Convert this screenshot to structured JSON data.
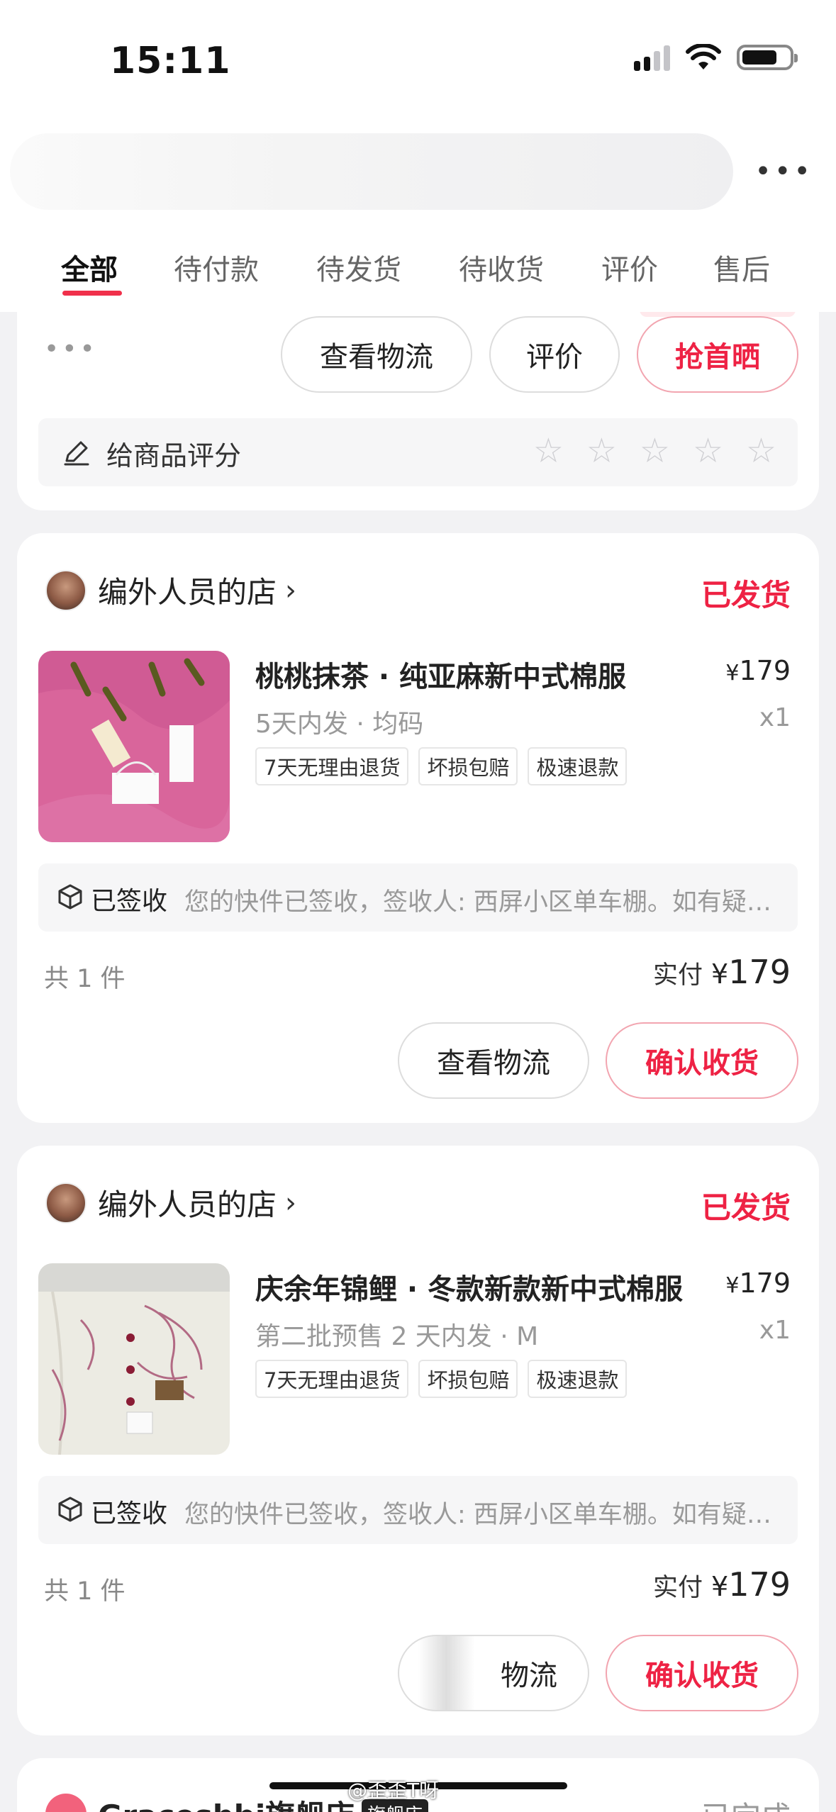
{
  "status_bar": {
    "time": "15:11"
  },
  "tabs": [
    {
      "label": "全部"
    },
    {
      "label": "待付款"
    },
    {
      "label": "待发货"
    },
    {
      "label": "待收货"
    },
    {
      "label": "评价"
    },
    {
      "label": "售后"
    }
  ],
  "first_card": {
    "buttons": {
      "logistics": "查看物流",
      "review": "评价",
      "first_review": "抢首晒"
    },
    "rating_label": "给商品评分",
    "stars": 5
  },
  "orders": [
    {
      "shop_name": "编外人员的店",
      "status": "已发货",
      "product_name": "桃桃抹茶 · 纯亚麻新中式棉服",
      "price_symbol": "¥",
      "price": "179",
      "spec": "5天内发 · 均码",
      "qty": "x1",
      "tags": [
        "7天无理由退货",
        "坏损包赔",
        "极速退款"
      ],
      "logistics_status": "已签收",
      "logistics_msg": "您的快件已签收，签收人: 西屏小区单车棚。如有疑问请联系",
      "count": "共 1 件",
      "paid_label": "实付",
      "paid_symbol": "¥",
      "paid_amount": "179",
      "btn_logistics": "查看物流",
      "btn_confirm": "确认收货"
    },
    {
      "shop_name": "编外人员的店",
      "status": "已发货",
      "product_name": "庆余年锦鲤 · 冬款新款新中式棉服",
      "price_symbol": "¥",
      "price": "179",
      "spec": "第二批预售 2 天内发 · M",
      "qty": "x1",
      "tags": [
        "7天无理由退货",
        "坏损包赔",
        "极速退款"
      ],
      "logistics_status": "已签收",
      "logistics_msg": "您的快件已签收，签收人: 西屏小区单车棚。如有疑问请联系",
      "count": "共 1 件",
      "paid_label": "实付",
      "paid_symbol": "¥",
      "paid_amount": "179",
      "btn_logistics": "物流",
      "btn_confirm": "确认收货"
    }
  ],
  "next_card": {
    "shop_name": "Graceshbi旗舰店",
    "shop_badge": "旗舰店",
    "status": "已完成"
  },
  "watermark": "@歪歪T呀",
  "colors": {
    "accent": "#ee2244",
    "background": "#f2f2f4"
  }
}
